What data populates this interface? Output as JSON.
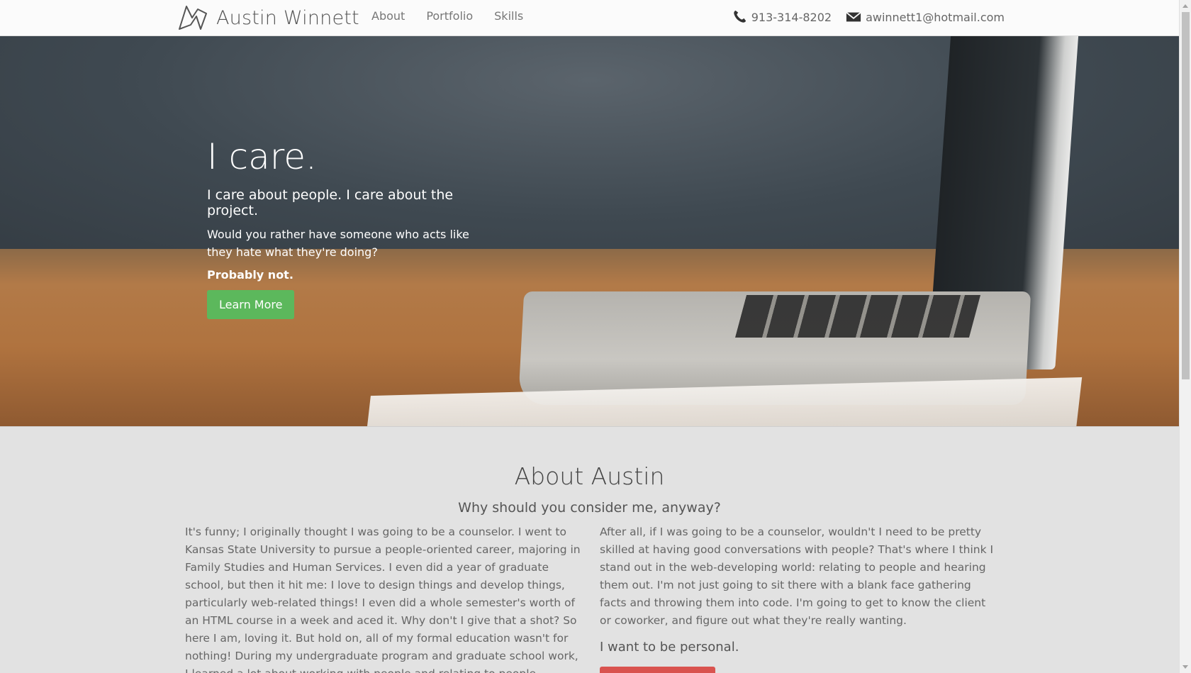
{
  "navbar": {
    "brand": "Austin Winnett",
    "links": [
      "About",
      "Portfolio",
      "Skills"
    ],
    "phone": "913-314-8202",
    "email": "awinnett1@hotmail.com"
  },
  "hero": {
    "title": "I care.",
    "lead": "I care about people. I care about the project.",
    "text": "Would you rather have someone who acts like they hate what they're doing?",
    "strong": "Probably not.",
    "button": "Learn More"
  },
  "about": {
    "title": "About Austin",
    "subtitle": "Why should you consider me, anyway?",
    "left_text": "It's funny; I originally thought I was going to be a counselor. I went to Kansas State University to pursue a people-oriented career, majoring in Family Studies and Human Services. I even did a year of graduate school, but then it hit me: I love to design things and develop things, particularly web-related things! I even did a whole semester's worth of an HTML course in a week and aced it. Why don't I give that a shot? So here I am, loving it. But hold on, all of my formal education wasn't for nothing! During my undergraduate program and graduate school work, I learned a lot about working with people and relating to people.",
    "right_text": "After all, if I was going to be a counselor, wouldn't I need to be pretty skilled at having good conversations with people? That's where I think I stand out in the web-developing world: relating to people and hearing them out. I'm not just going to sit there with a blank face gathering facts and throwing them into code. I'm going to get to know the client or coworker, and figure out what they're really wanting.",
    "right_strong": "I want to be personal."
  },
  "colors": {
    "success": "#5cb85c",
    "danger": "#d9534f"
  }
}
